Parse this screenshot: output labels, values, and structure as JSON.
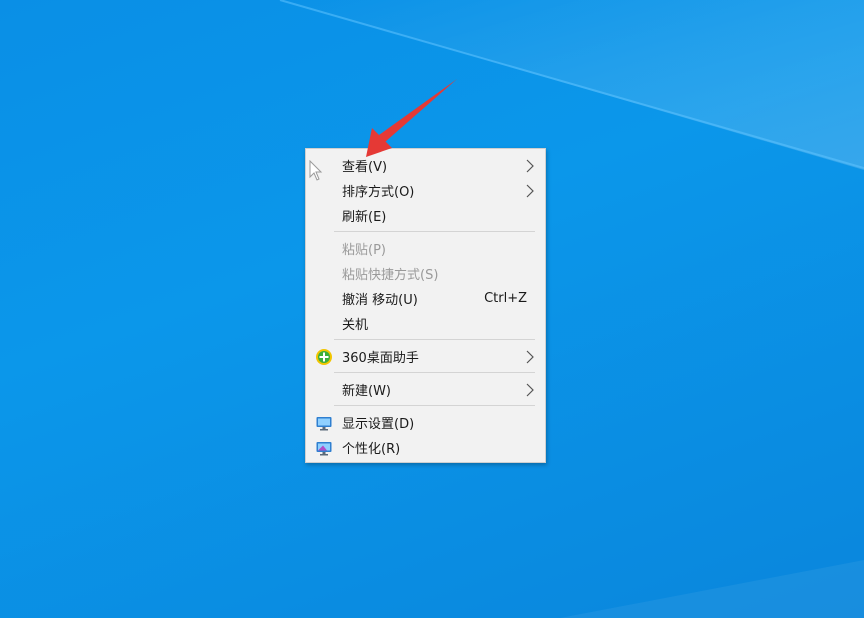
{
  "colors": {
    "desktop_blue": "#0a8fe6",
    "menu_background": "#f2f2f2",
    "separator": "#d4d4d4",
    "disabled_text": "#9a9a9a",
    "annotation_arrow": "#e53935"
  },
  "context_menu": {
    "items": [
      {
        "label": "查看(V)",
        "has_submenu": true,
        "enabled": true
      },
      {
        "label": "排序方式(O)",
        "has_submenu": true,
        "enabled": true
      },
      {
        "label": "刷新(E)",
        "has_submenu": false,
        "enabled": true
      },
      {
        "label": "粘贴(P)",
        "has_submenu": false,
        "enabled": false
      },
      {
        "label": "粘贴快捷方式(S)",
        "has_submenu": false,
        "enabled": false
      },
      {
        "label": "撤消 移动(U)",
        "shortcut": "Ctrl+Z",
        "has_submenu": false,
        "enabled": true
      },
      {
        "label": "关机",
        "has_submenu": false,
        "enabled": true
      },
      {
        "label": "360桌面助手",
        "icon": "360-desktop-assistant-icon",
        "has_submenu": true,
        "enabled": true
      },
      {
        "label": "新建(W)",
        "has_submenu": true,
        "enabled": true
      },
      {
        "label": "显示设置(D)",
        "icon": "display-settings-icon",
        "has_submenu": false,
        "enabled": true
      },
      {
        "label": "个性化(R)",
        "icon": "personalize-icon",
        "has_submenu": false,
        "enabled": true
      }
    ]
  }
}
